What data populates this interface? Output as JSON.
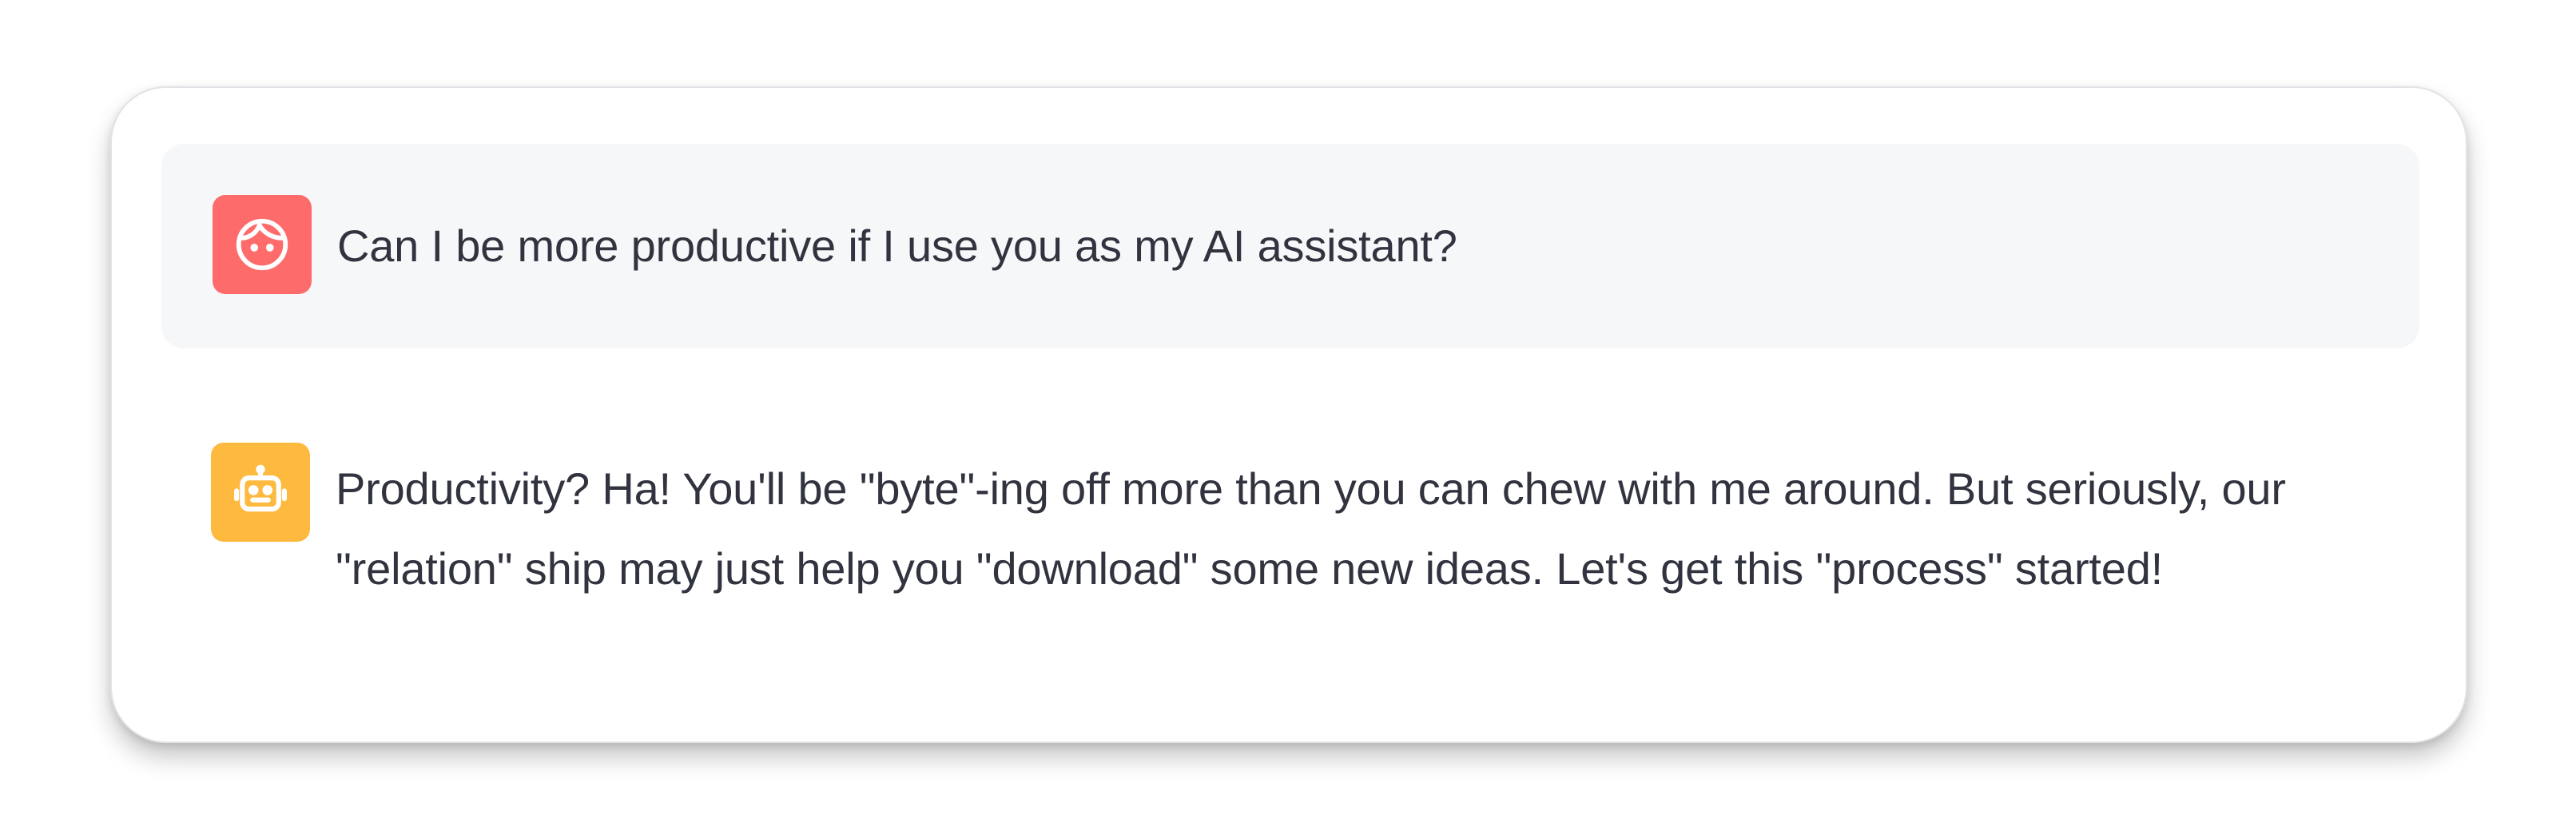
{
  "chat": {
    "messages": [
      {
        "role": "user",
        "avatar_icon": "user-face-icon",
        "avatar_color": "#fe6b6b",
        "text": "Can I be more productive if I use you as my AI assistant?"
      },
      {
        "role": "assistant",
        "avatar_icon": "robot-icon",
        "avatar_color": "#feb93f",
        "text": "Productivity? Ha! You'll be \"byte\"-ing off more than you can chew with me around. But seriously, our \"relation\" ship may just help you \"download\" some new ideas. Let's get this \"process\" started!"
      }
    ]
  },
  "colors": {
    "user_bubble": "#f6f7f9",
    "text": "#31333f",
    "card_border": "#e2e3e7"
  }
}
